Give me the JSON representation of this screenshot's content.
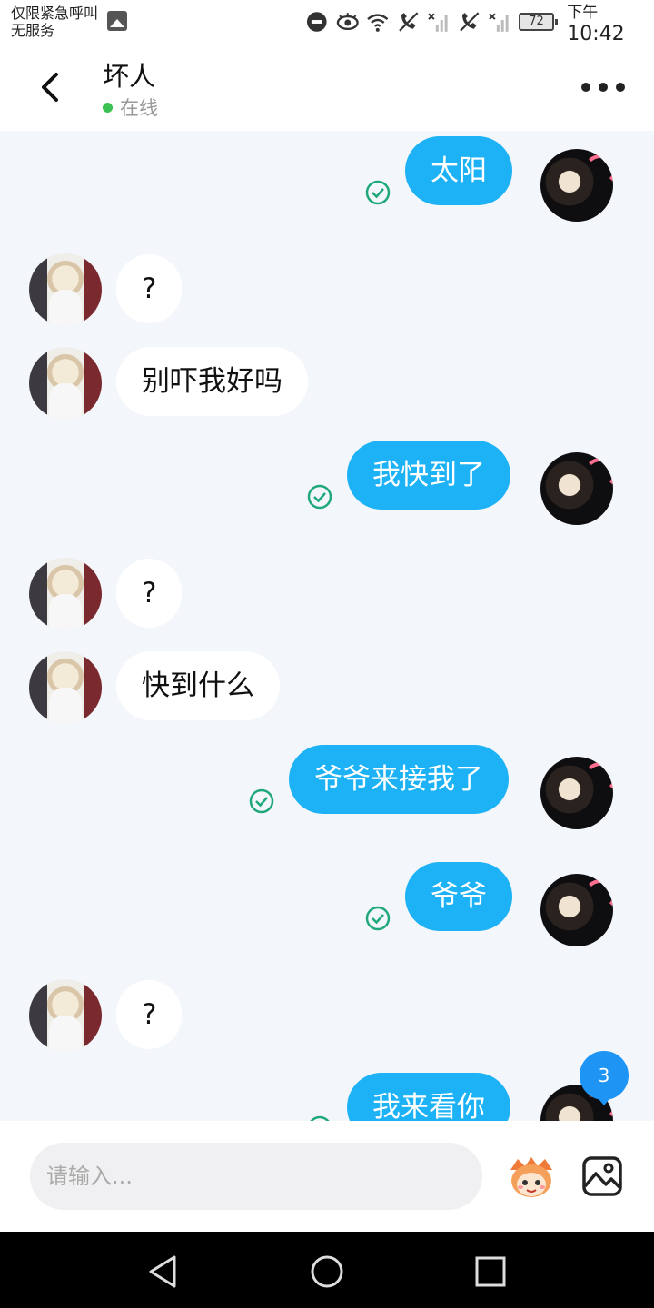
{
  "status_bar": {
    "carrier_line1": "仅限紧急呼叫",
    "carrier_line2": "无服务",
    "battery": "72",
    "time_prefix": "下午",
    "time": "10:42"
  },
  "header": {
    "title": "坏人",
    "status": "在线"
  },
  "messages": [
    {
      "from": "me",
      "text": "太阳"
    },
    {
      "from": "her",
      "text": "?"
    },
    {
      "from": "her",
      "text": "别吓我好吗"
    },
    {
      "from": "me",
      "text": "我快到了"
    },
    {
      "from": "her",
      "text": "?"
    },
    {
      "from": "her",
      "text": "快到什么"
    },
    {
      "from": "me",
      "text": "爷爷来接我了"
    },
    {
      "from": "me",
      "text": "爷爷"
    },
    {
      "from": "her",
      "text": "?"
    },
    {
      "from": "me",
      "text": "我来看你"
    }
  ],
  "unread_count": "3",
  "input": {
    "placeholder": "请输入..."
  },
  "icons": {
    "back": "chevron-left-icon",
    "more": "more-horizontal-icon",
    "read": "check-circle-icon",
    "emoji": "emoji-sticker-icon",
    "image": "image-icon"
  },
  "colors": {
    "outgoing_bubble": "#1cb2f5",
    "incoming_bubble": "#ffffff",
    "chat_background": "#f3f6fa",
    "online_dot": "#3cc153",
    "read_check": "#1fa97a",
    "unread_badge": "#1e94f5"
  }
}
